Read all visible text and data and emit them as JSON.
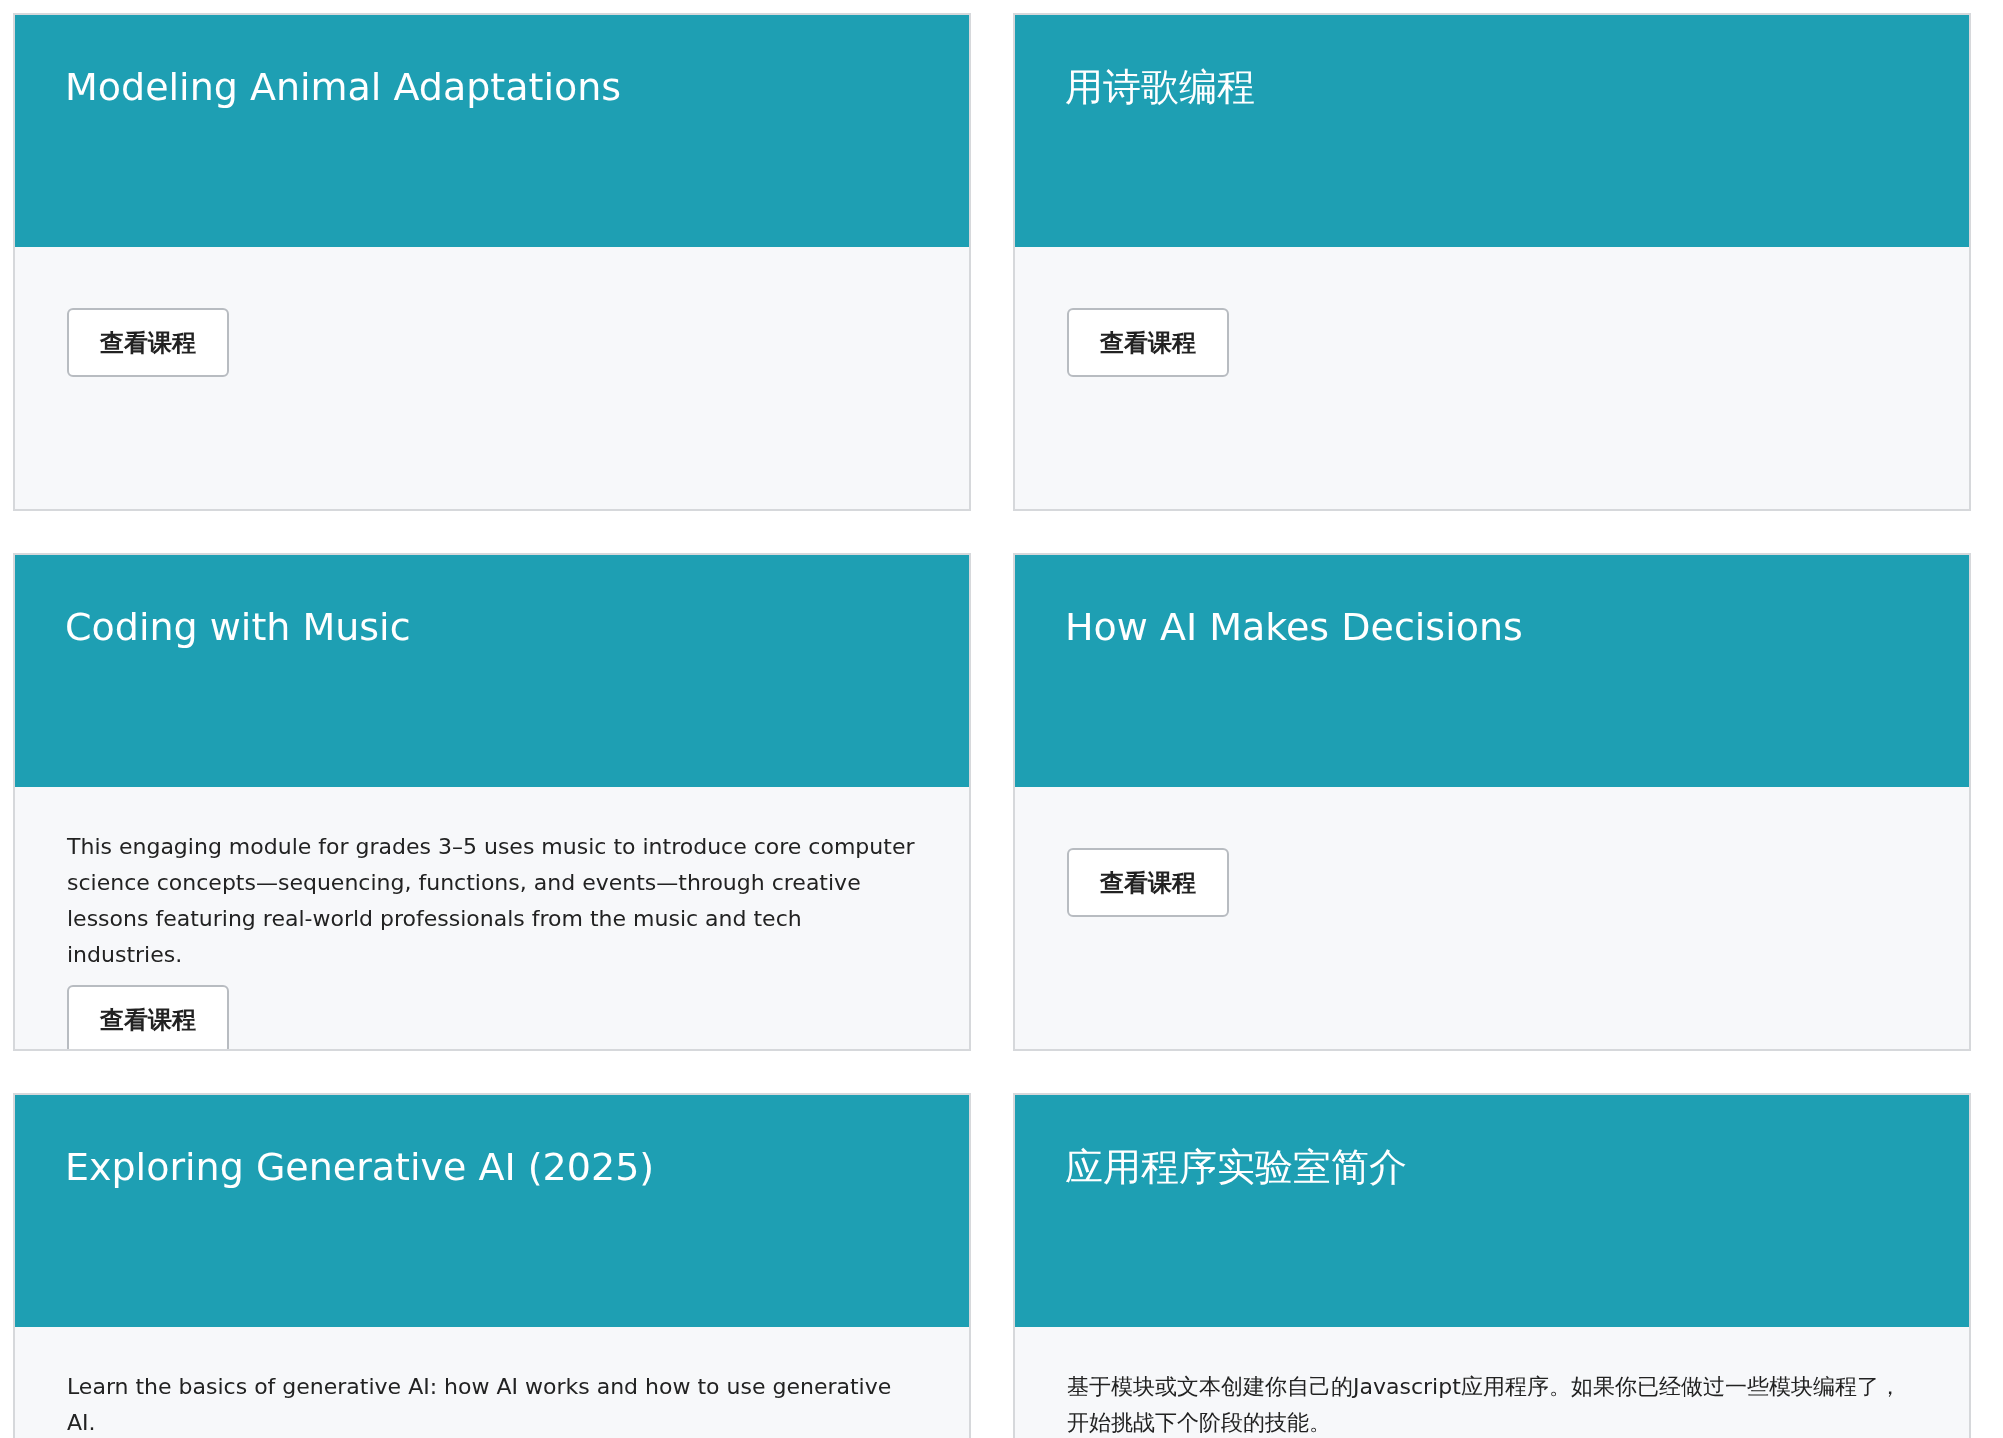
{
  "cards": [
    {
      "title": "Modeling Animal Adaptations",
      "button": "查看课程"
    },
    {
      "title": "用诗歌编程",
      "button": "查看课程"
    },
    {
      "title": "Coding with Music",
      "description": "This engaging module for grades 3–5 uses music to introduce core computer science concepts—sequencing, functions, and events—through creative lessons featuring real-world professionals from the music and tech industries.",
      "button": "查看课程"
    },
    {
      "title": "How AI Makes Decisions",
      "button": "查看课程"
    },
    {
      "title": "Exploring Generative AI (2025)",
      "description": "Learn the basics of generative AI: how AI works and how to use generative AI."
    },
    {
      "title": "应用程序实验室简介",
      "description": "基于模块或文本创建你自己的Javascript应用程序。如果你已经做过一些模块编程了，开始挑战下个阶段的技能。"
    }
  ]
}
